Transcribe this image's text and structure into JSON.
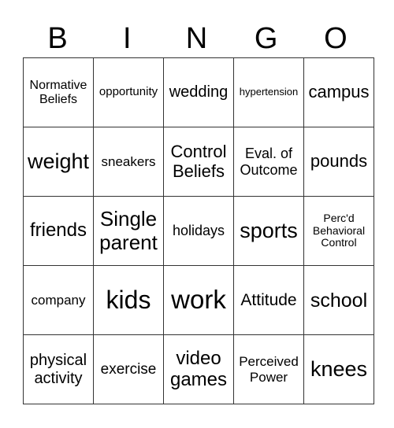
{
  "header": [
    "B",
    "I",
    "N",
    "G",
    "O"
  ],
  "rows": [
    [
      {
        "text": "Normative Beliefs",
        "size": 16
      },
      {
        "text": "opportunity",
        "size": 15
      },
      {
        "text": "wedding",
        "size": 20
      },
      {
        "text": "hypertension",
        "size": 13
      },
      {
        "text": "campus",
        "size": 22
      }
    ],
    [
      {
        "text": "weight",
        "size": 27
      },
      {
        "text": "sneakers",
        "size": 17
      },
      {
        "text": "Control Beliefs",
        "size": 22
      },
      {
        "text": "Eval. of Outcome",
        "size": 18
      },
      {
        "text": "pounds",
        "size": 22
      }
    ],
    [
      {
        "text": "friends",
        "size": 24
      },
      {
        "text": "Single parent",
        "size": 26
      },
      {
        "text": "holidays",
        "size": 18
      },
      {
        "text": "sports",
        "size": 27
      },
      {
        "text": "Perc'd Behavioral Control",
        "size": 14
      }
    ],
    [
      {
        "text": "company",
        "size": 17
      },
      {
        "text": "kids",
        "size": 32
      },
      {
        "text": "work",
        "size": 33
      },
      {
        "text": "Attitude",
        "size": 21
      },
      {
        "text": "school",
        "size": 25
      }
    ],
    [
      {
        "text": "physical activity",
        "size": 20
      },
      {
        "text": "exercise",
        "size": 19
      },
      {
        "text": "video games",
        "size": 24
      },
      {
        "text": "Perceived Power",
        "size": 17
      },
      {
        "text": "knees",
        "size": 27
      }
    ]
  ]
}
